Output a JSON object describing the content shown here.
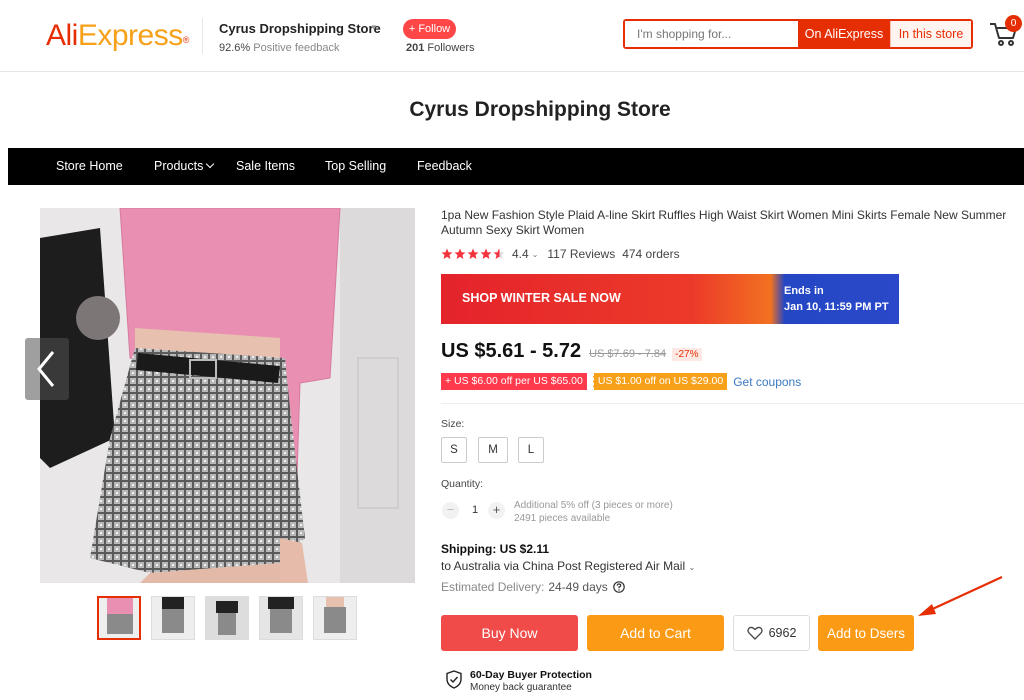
{
  "header": {
    "logo_ali": "Ali",
    "logo_express": "Express",
    "logo_reg": "®",
    "store_name": "Cyrus Dropshipping Store",
    "feedback_pct": "92.6%",
    "feedback_label": " Positive feedback",
    "follow_label": "+ Follow",
    "followers_count": "201",
    "followers_label": " Followers",
    "search_placeholder": "I'm shopping for...",
    "search_on_ali": "On AliExpress",
    "search_in_store": "In this store",
    "cart_count": "0"
  },
  "store_title": "Cyrus Dropshipping Store",
  "nav": {
    "items": [
      "Store Home",
      "Products",
      "Sale Items",
      "Top Selling",
      "Feedback"
    ]
  },
  "product": {
    "title": "1pa New Fashion Style Plaid A-line Skirt Ruffles High Waist Skirt Women Mini Skirts Female New Summer Autumn Sexy Skirt Women",
    "rating": "4.4",
    "reviews": "117 Reviews",
    "orders": "474 orders",
    "sale_banner": "SHOP WINTER SALE NOW",
    "sale_ends_label": "Ends in",
    "sale_ends_date": "Jan 10, 11:59 PM PT",
    "price": "US $5.61 - 5.72",
    "original_price": "US $7.69 - 7.84",
    "discount": "-27%",
    "coupon_1": "+ US $6.00 off per US $65.00",
    "coupon_2": "US $1.00 off on US $29.00",
    "get_coupons": "Get coupons",
    "size_label": "Size:",
    "sizes": [
      "S",
      "M",
      "L"
    ],
    "quantity_label": "Quantity:",
    "quantity": "1",
    "qty_note_1": "Additional 5% off (3 pieces or more)",
    "qty_note_2": "2491 pieces available",
    "shipping_title": "Shipping: US $2.11",
    "shipping_via": "to Australia via China Post Registered Air Mail",
    "est_delivery_label": "Estimated Delivery:",
    "est_delivery_value": "24-49 days",
    "buy_now": "Buy Now",
    "add_to_cart": "Add to Cart",
    "wishlist_count": "6962",
    "add_to_dsers": "Add to Dsers",
    "protection_title": "60-Day Buyer Protection",
    "protection_sub": "Money back guarantee"
  },
  "colors": {
    "brand_red": "#e62e04",
    "brand_orange": "#f7a11a",
    "buy_now": "#f04b49",
    "add_to_cart": "#fb9b15"
  },
  "icons": {
    "cart": "cart-icon",
    "star": "star-icon",
    "heart": "heart-icon",
    "help": "question-icon",
    "shield": "shield-check-icon",
    "prev": "chevron-left-icon"
  }
}
